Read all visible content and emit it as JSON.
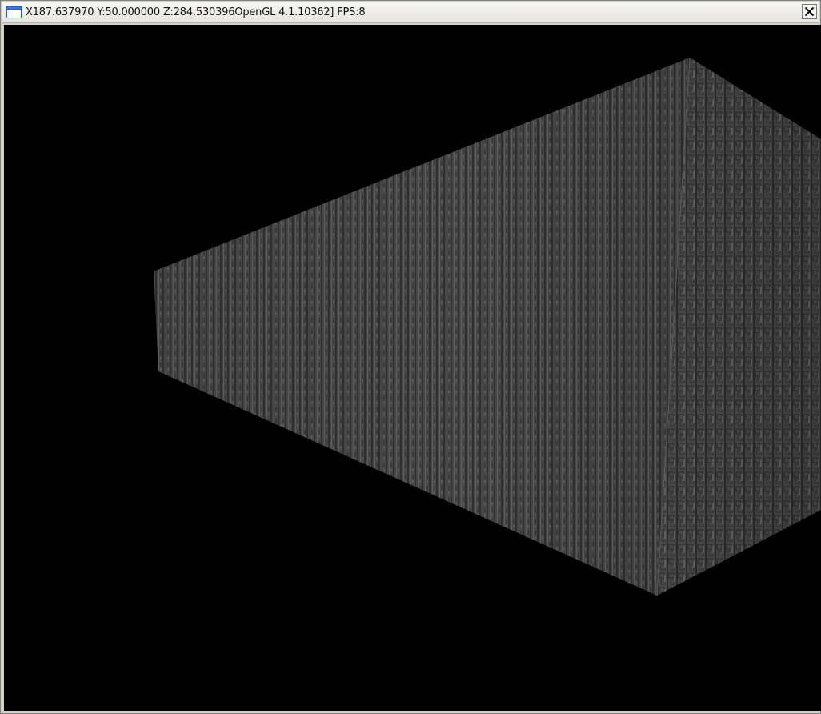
{
  "window": {
    "title": "X187.637970 Y:50.000000 Z:284.530396OpenGL 4.1.10362] FPS:8",
    "close_label": "×"
  },
  "icons": {
    "app": "window-icon",
    "close": "close-icon"
  },
  "scene": {
    "background_color": "#000000",
    "wall_color": "#4a4a4a",
    "wall_dark": "#2e2e2e",
    "wall_light": "#6a6a6a"
  }
}
